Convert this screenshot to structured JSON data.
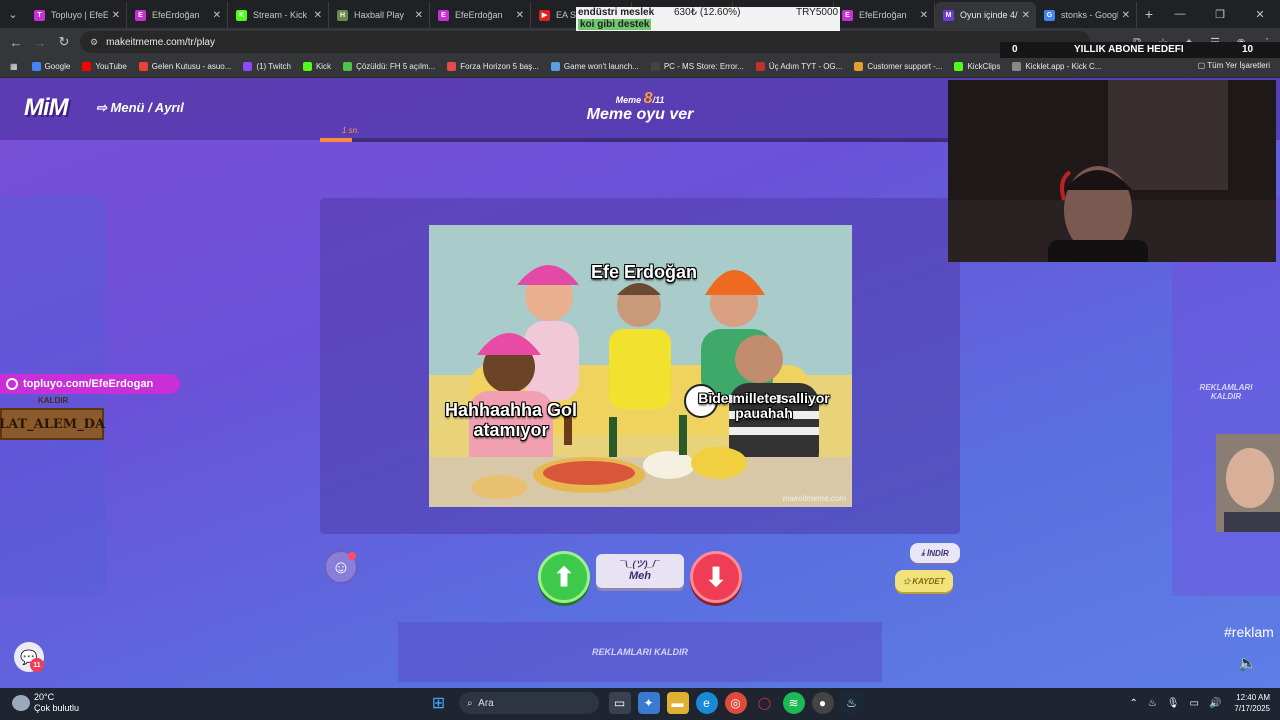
{
  "browser": {
    "tabs": [
      {
        "title": "Topluyo | EfeErdoğan",
        "color": "#c92fd6",
        "glyph": "T"
      },
      {
        "title": "EfeErdoğan",
        "color": "#c92fd6",
        "glyph": "E"
      },
      {
        "title": "Stream - Kick Dashboard",
        "color": "#53fc18",
        "glyph": "K"
      },
      {
        "title": "Haxball Play",
        "color": "#6a8a4a",
        "glyph": "H"
      },
      {
        "title": "EfeErdoğan",
        "color": "#c92fd6",
        "glyph": "E"
      },
      {
        "title": "EA SPORTS",
        "color": "#e02020",
        "glyph": "▶"
      },
      {
        "title": "",
        "color": "#555555",
        "glyph": ""
      },
      {
        "title": "",
        "color": "#555555",
        "glyph": ""
      },
      {
        "title": "EfeErdoğan",
        "color": "#c92fd6",
        "glyph": "E"
      },
      {
        "title": "Oyun içinde 4/11",
        "color": "#6a3fd0",
        "glyph": "M"
      },
      {
        "title": "stonks - Google",
        "color": "#4285f4",
        "glyph": "G"
      }
    ],
    "active_tab_index": 9,
    "url": "makeitmeme.com/tr/play",
    "bookmarks": [
      {
        "label": "Google",
        "color": "#4285f4"
      },
      {
        "label": "YouTube",
        "color": "#ff0000"
      },
      {
        "label": "Gelen Kutusu - asuo...",
        "color": "#ea4335"
      },
      {
        "label": "(1) Twitch",
        "color": "#9146ff"
      },
      {
        "label": "Kick",
        "color": "#53fc18"
      },
      {
        "label": "Çözüldü: FH 5 açılm...",
        "color": "#53c24a"
      },
      {
        "label": "Forza Horizon 5 baş...",
        "color": "#e84a4a"
      },
      {
        "label": "Game won't launch...",
        "color": "#5aa0e0"
      },
      {
        "label": "PC - MS Store: Error...",
        "color": "#444444"
      },
      {
        "label": "Üç Adım TYT - OG...",
        "color": "#c03030"
      },
      {
        "label": "Customer support -...",
        "color": "#e0a030"
      },
      {
        "label": "KickClips",
        "color": "#53fc18"
      },
      {
        "label": "Kicklet.app - Kick C...",
        "color": "#888888"
      }
    ],
    "all_bookmarks_label": "Tüm Yer İşaretleri"
  },
  "overlay": {
    "ticker_line1": "endüstri meslek",
    "ticker_price": "630₺ (12.60%)",
    "ticker_goal": "TRY5000",
    "ticker_line2": "koi gibi destek",
    "sub_left": "0",
    "sub_label": "YILLIK ABONE HEDEFI",
    "sub_right": "10",
    "promo_link": "topluyo.com/EfeErdogan",
    "sign_small": "KALDIR",
    "sign_text": "LAT_ALEM_DA"
  },
  "game": {
    "logo": "MiM",
    "menu_label": "Menü / Ayrıl",
    "round_prefix": "Meme",
    "round_current": "8",
    "round_total": "/11",
    "round_title": "Meme oyu ver",
    "timer": "1 sn.",
    "progress_fraction": 0.05,
    "meme": {
      "caption_top": "Efe Erdoğan",
      "caption_left": "Hahhaahha Gol atamıyor",
      "caption_right": "Bide millete salliyor pauahah",
      "watermark": "makeitmeme.com"
    },
    "meh_kaomoji": "¯\\_(ツ)_/¯",
    "meh_label": "Meh",
    "download_label": "İNDİR",
    "save_label": "KAYDET",
    "remove_ads_bottom": "REKLAMLARI KALDIR",
    "remove_ads_right": "REKLAMLARI KALDIR",
    "chat_count": "11",
    "hashtag": "#reklam"
  },
  "taskbar": {
    "temp": "20°C",
    "weather": "Çok bulutlu",
    "search_placeholder": "Ara",
    "time": "12:40 AM",
    "date": "7/17/2025"
  }
}
